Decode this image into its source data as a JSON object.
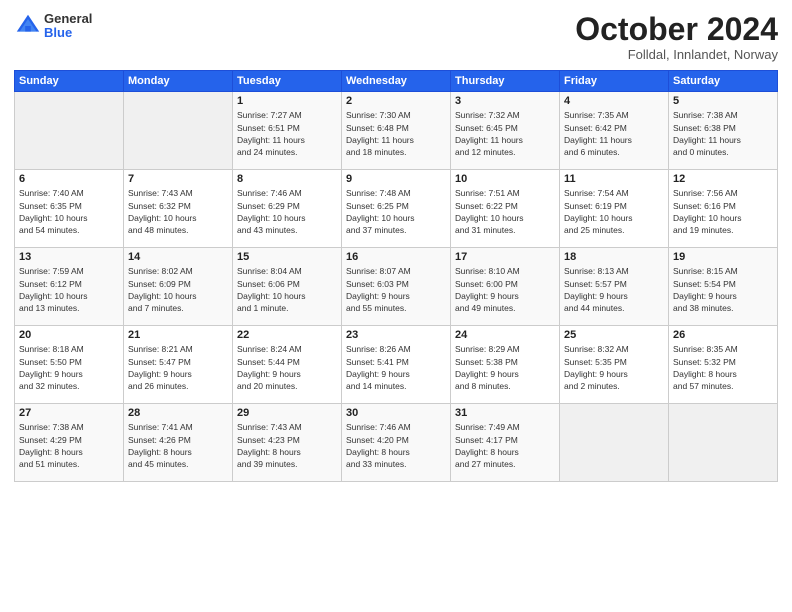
{
  "logo": {
    "general": "General",
    "blue": "Blue"
  },
  "title": "October 2024",
  "location": "Folldal, Innlandet, Norway",
  "days_header": [
    "Sunday",
    "Monday",
    "Tuesday",
    "Wednesday",
    "Thursday",
    "Friday",
    "Saturday"
  ],
  "weeks": [
    [
      {
        "day": "",
        "info": ""
      },
      {
        "day": "",
        "info": ""
      },
      {
        "day": "1",
        "info": "Sunrise: 7:27 AM\nSunset: 6:51 PM\nDaylight: 11 hours\nand 24 minutes."
      },
      {
        "day": "2",
        "info": "Sunrise: 7:30 AM\nSunset: 6:48 PM\nDaylight: 11 hours\nand 18 minutes."
      },
      {
        "day": "3",
        "info": "Sunrise: 7:32 AM\nSunset: 6:45 PM\nDaylight: 11 hours\nand 12 minutes."
      },
      {
        "day": "4",
        "info": "Sunrise: 7:35 AM\nSunset: 6:42 PM\nDaylight: 11 hours\nand 6 minutes."
      },
      {
        "day": "5",
        "info": "Sunrise: 7:38 AM\nSunset: 6:38 PM\nDaylight: 11 hours\nand 0 minutes."
      }
    ],
    [
      {
        "day": "6",
        "info": "Sunrise: 7:40 AM\nSunset: 6:35 PM\nDaylight: 10 hours\nand 54 minutes."
      },
      {
        "day": "7",
        "info": "Sunrise: 7:43 AM\nSunset: 6:32 PM\nDaylight: 10 hours\nand 48 minutes."
      },
      {
        "day": "8",
        "info": "Sunrise: 7:46 AM\nSunset: 6:29 PM\nDaylight: 10 hours\nand 43 minutes."
      },
      {
        "day": "9",
        "info": "Sunrise: 7:48 AM\nSunset: 6:25 PM\nDaylight: 10 hours\nand 37 minutes."
      },
      {
        "day": "10",
        "info": "Sunrise: 7:51 AM\nSunset: 6:22 PM\nDaylight: 10 hours\nand 31 minutes."
      },
      {
        "day": "11",
        "info": "Sunrise: 7:54 AM\nSunset: 6:19 PM\nDaylight: 10 hours\nand 25 minutes."
      },
      {
        "day": "12",
        "info": "Sunrise: 7:56 AM\nSunset: 6:16 PM\nDaylight: 10 hours\nand 19 minutes."
      }
    ],
    [
      {
        "day": "13",
        "info": "Sunrise: 7:59 AM\nSunset: 6:12 PM\nDaylight: 10 hours\nand 13 minutes."
      },
      {
        "day": "14",
        "info": "Sunrise: 8:02 AM\nSunset: 6:09 PM\nDaylight: 10 hours\nand 7 minutes."
      },
      {
        "day": "15",
        "info": "Sunrise: 8:04 AM\nSunset: 6:06 PM\nDaylight: 10 hours\nand 1 minute."
      },
      {
        "day": "16",
        "info": "Sunrise: 8:07 AM\nSunset: 6:03 PM\nDaylight: 9 hours\nand 55 minutes."
      },
      {
        "day": "17",
        "info": "Sunrise: 8:10 AM\nSunset: 6:00 PM\nDaylight: 9 hours\nand 49 minutes."
      },
      {
        "day": "18",
        "info": "Sunrise: 8:13 AM\nSunset: 5:57 PM\nDaylight: 9 hours\nand 44 minutes."
      },
      {
        "day": "19",
        "info": "Sunrise: 8:15 AM\nSunset: 5:54 PM\nDaylight: 9 hours\nand 38 minutes."
      }
    ],
    [
      {
        "day": "20",
        "info": "Sunrise: 8:18 AM\nSunset: 5:50 PM\nDaylight: 9 hours\nand 32 minutes."
      },
      {
        "day": "21",
        "info": "Sunrise: 8:21 AM\nSunset: 5:47 PM\nDaylight: 9 hours\nand 26 minutes."
      },
      {
        "day": "22",
        "info": "Sunrise: 8:24 AM\nSunset: 5:44 PM\nDaylight: 9 hours\nand 20 minutes."
      },
      {
        "day": "23",
        "info": "Sunrise: 8:26 AM\nSunset: 5:41 PM\nDaylight: 9 hours\nand 14 minutes."
      },
      {
        "day": "24",
        "info": "Sunrise: 8:29 AM\nSunset: 5:38 PM\nDaylight: 9 hours\nand 8 minutes."
      },
      {
        "day": "25",
        "info": "Sunrise: 8:32 AM\nSunset: 5:35 PM\nDaylight: 9 hours\nand 2 minutes."
      },
      {
        "day": "26",
        "info": "Sunrise: 8:35 AM\nSunset: 5:32 PM\nDaylight: 8 hours\nand 57 minutes."
      }
    ],
    [
      {
        "day": "27",
        "info": "Sunrise: 7:38 AM\nSunset: 4:29 PM\nDaylight: 8 hours\nand 51 minutes."
      },
      {
        "day": "28",
        "info": "Sunrise: 7:41 AM\nSunset: 4:26 PM\nDaylight: 8 hours\nand 45 minutes."
      },
      {
        "day": "29",
        "info": "Sunrise: 7:43 AM\nSunset: 4:23 PM\nDaylight: 8 hours\nand 39 minutes."
      },
      {
        "day": "30",
        "info": "Sunrise: 7:46 AM\nSunset: 4:20 PM\nDaylight: 8 hours\nand 33 minutes."
      },
      {
        "day": "31",
        "info": "Sunrise: 7:49 AM\nSunset: 4:17 PM\nDaylight: 8 hours\nand 27 minutes."
      },
      {
        "day": "",
        "info": ""
      },
      {
        "day": "",
        "info": ""
      }
    ]
  ]
}
